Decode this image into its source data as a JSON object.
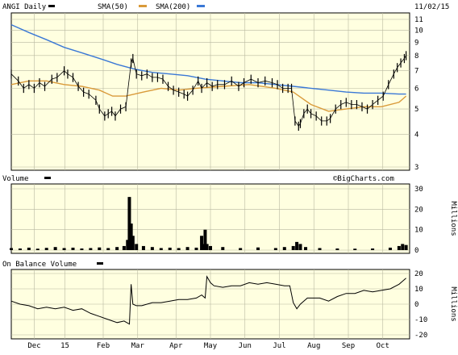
{
  "chart_data": [
    {
      "type": "line",
      "title": "ANGI Daily",
      "date": "11/02/15",
      "legend": [
        {
          "name": "ANGI Daily",
          "color": "#000000"
        },
        {
          "name": "SMA(50)",
          "color": "#d99a3a"
        },
        {
          "name": "SMA(200)",
          "color": "#3a78d6"
        }
      ],
      "x_months": [
        "Dec",
        "15",
        "Feb",
        "Mar",
        "Apr",
        "May",
        "Jun",
        "Jul",
        "Aug",
        "Sep",
        "Oct"
      ],
      "ylim": [
        3,
        11
      ],
      "y_ticks": [
        3,
        4,
        5,
        6,
        7,
        8,
        9,
        10,
        11
      ],
      "y_scale": "log",
      "grid": true,
      "series": [
        {
          "name": "ANGI Daily",
          "points": [
            [
              0,
              6.8
            ],
            [
              8,
              6.4
            ],
            [
              14,
              6.0
            ],
            [
              20,
              6.2
            ],
            [
              26,
              6.0
            ],
            [
              32,
              6.3
            ],
            [
              38,
              6.1
            ],
            [
              46,
              6.5
            ],
            [
              52,
              6.6
            ],
            [
              60,
              7.0
            ],
            [
              64,
              6.8
            ],
            [
              70,
              6.6
            ],
            [
              76,
              6.1
            ],
            [
              82,
              5.8
            ],
            [
              88,
              5.7
            ],
            [
              96,
              5.4
            ],
            [
              100,
              5.0
            ],
            [
              106,
              4.7
            ],
            [
              110,
              4.8
            ],
            [
              114,
              4.9
            ],
            [
              118,
              4.7
            ],
            [
              124,
              5.0
            ],
            [
              130,
              5.1
            ],
            [
              136,
              7.5
            ],
            [
              138,
              7.8
            ],
            [
              142,
              6.8
            ],
            [
              148,
              6.7
            ],
            [
              154,
              6.8
            ],
            [
              160,
              6.6
            ],
            [
              166,
              6.6
            ],
            [
              172,
              6.5
            ],
            [
              178,
              6.1
            ],
            [
              184,
              5.9
            ],
            [
              190,
              5.8
            ],
            [
              196,
              5.7
            ],
            [
              200,
              5.6
            ],
            [
              206,
              5.9
            ],
            [
              212,
              6.4
            ],
            [
              216,
              6.0
            ],
            [
              222,
              6.3
            ],
            [
              228,
              6.1
            ],
            [
              234,
              6.2
            ],
            [
              242,
              6.2
            ],
            [
              250,
              6.4
            ],
            [
              258,
              6.1
            ],
            [
              264,
              6.3
            ],
            [
              272,
              6.5
            ],
            [
              280,
              6.3
            ],
            [
              288,
              6.4
            ],
            [
              296,
              6.3
            ],
            [
              302,
              6.2
            ],
            [
              308,
              6.0
            ],
            [
              314,
              6.0
            ],
            [
              318,
              6.0
            ],
            [
              322,
              4.5
            ],
            [
              326,
              4.3
            ],
            [
              328,
              4.4
            ],
            [
              332,
              4.8
            ],
            [
              336,
              5.0
            ],
            [
              340,
              4.8
            ],
            [
              346,
              4.7
            ],
            [
              352,
              4.5
            ],
            [
              358,
              4.5
            ],
            [
              362,
              4.6
            ],
            [
              368,
              5.0
            ],
            [
              374,
              5.2
            ],
            [
              380,
              5.3
            ],
            [
              386,
              5.2
            ],
            [
              392,
              5.2
            ],
            [
              398,
              5.1
            ],
            [
              404,
              5.0
            ],
            [
              410,
              5.2
            ],
            [
              416,
              5.4
            ],
            [
              422,
              5.6
            ],
            [
              428,
              6.2
            ],
            [
              434,
              6.8
            ],
            [
              438,
              7.2
            ],
            [
              442,
              7.5
            ],
            [
              446,
              7.8
            ],
            [
              448,
              8.0
            ]
          ]
        },
        {
          "name": "SMA(50)",
          "points": [
            [
              0,
              6.2
            ],
            [
              20,
              6.4
            ],
            [
              40,
              6.4
            ],
            [
              60,
              6.2
            ],
            [
              80,
              6.1
            ],
            [
              100,
              5.9
            ],
            [
              115,
              5.6
            ],
            [
              130,
              5.6
            ],
            [
              150,
              5.8
            ],
            [
              170,
              6.0
            ],
            [
              190,
              5.9
            ],
            [
              210,
              6.0
            ],
            [
              240,
              6.1
            ],
            [
              270,
              6.2
            ],
            [
              300,
              6.0
            ],
            [
              320,
              5.8
            ],
            [
              340,
              5.2
            ],
            [
              360,
              4.9
            ],
            [
              380,
              5.0
            ],
            [
              400,
              5.1
            ],
            [
              420,
              5.1
            ],
            [
              440,
              5.3
            ],
            [
              448,
              5.6
            ]
          ]
        },
        {
          "name": "SMA(200)",
          "points": [
            [
              0,
              10.5
            ],
            [
              20,
              9.8
            ],
            [
              40,
              9.2
            ],
            [
              60,
              8.6
            ],
            [
              80,
              8.2
            ],
            [
              100,
              7.8
            ],
            [
              120,
              7.4
            ],
            [
              140,
              7.1
            ],
            [
              160,
              6.9
            ],
            [
              180,
              6.8
            ],
            [
              200,
              6.7
            ],
            [
              220,
              6.5
            ],
            [
              240,
              6.4
            ],
            [
              260,
              6.3
            ],
            [
              280,
              6.3
            ],
            [
              300,
              6.2
            ],
            [
              320,
              6.1
            ],
            [
              340,
              6.0
            ],
            [
              360,
              5.9
            ],
            [
              380,
              5.8
            ],
            [
              400,
              5.75
            ],
            [
              420,
              5.75
            ],
            [
              440,
              5.7
            ],
            [
              448,
              5.7
            ]
          ]
        }
      ]
    },
    {
      "type": "bar",
      "title": "Volume",
      "watermark": "©BigCharts.com",
      "ylabel": "Millions",
      "ylim": [
        0,
        30
      ],
      "y_ticks": [
        0,
        10,
        20,
        30
      ],
      "series": [
        {
          "name": "Volume",
          "points": [
            [
              0,
              1
            ],
            [
              10,
              0.8
            ],
            [
              20,
              1.2
            ],
            [
              30,
              0.7
            ],
            [
              40,
              1.1
            ],
            [
              50,
              1.5
            ],
            [
              60,
              1.0
            ],
            [
              70,
              1.2
            ],
            [
              80,
              0.8
            ],
            [
              90,
              1.0
            ],
            [
              100,
              1.3
            ],
            [
              110,
              1.0
            ],
            [
              120,
              1.5
            ],
            [
              128,
              2
            ],
            [
              132,
              5
            ],
            [
              134,
              26
            ],
            [
              136,
              13
            ],
            [
              138,
              7
            ],
            [
              142,
              3
            ],
            [
              150,
              2
            ],
            [
              160,
              1.5
            ],
            [
              170,
              1.0
            ],
            [
              180,
              1.2
            ],
            [
              190,
              1.0
            ],
            [
              200,
              1.5
            ],
            [
              210,
              1.2
            ],
            [
              216,
              7
            ],
            [
              218,
              3
            ],
            [
              220,
              10
            ],
            [
              222,
              3
            ],
            [
              226,
              2
            ],
            [
              240,
              1.5
            ],
            [
              260,
              1.0
            ],
            [
              280,
              1.3
            ],
            [
              300,
              1.0
            ],
            [
              310,
              1.5
            ],
            [
              320,
              2
            ],
            [
              324,
              4
            ],
            [
              328,
              3
            ],
            [
              334,
              1.5
            ],
            [
              350,
              1.0
            ],
            [
              370,
              0.8
            ],
            [
              390,
              0.7
            ],
            [
              410,
              0.8
            ],
            [
              430,
              1.2
            ],
            [
              440,
              2
            ],
            [
              444,
              3
            ],
            [
              448,
              2.5
            ]
          ]
        }
      ]
    },
    {
      "type": "line",
      "title": "On Balance Volume",
      "ylabel": "Millions",
      "ylim": [
        -20,
        20
      ],
      "y_ticks": [
        -20,
        -10,
        0,
        10,
        20
      ],
      "series": [
        {
          "name": "On Balance Volume",
          "points": [
            [
              0,
              2
            ],
            [
              10,
              0
            ],
            [
              20,
              -1
            ],
            [
              30,
              -3
            ],
            [
              40,
              -2
            ],
            [
              50,
              -3
            ],
            [
              60,
              -2
            ],
            [
              70,
              -4
            ],
            [
              80,
              -3
            ],
            [
              90,
              -6
            ],
            [
              100,
              -8
            ],
            [
              110,
              -10
            ],
            [
              120,
              -12
            ],
            [
              128,
              -11
            ],
            [
              134,
              -13
            ],
            [
              136,
              13
            ],
            [
              138,
              0
            ],
            [
              142,
              -1
            ],
            [
              148,
              -1
            ],
            [
              160,
              1
            ],
            [
              170,
              1
            ],
            [
              180,
              2
            ],
            [
              190,
              3
            ],
            [
              200,
              3
            ],
            [
              210,
              4
            ],
            [
              216,
              6
            ],
            [
              220,
              4
            ],
            [
              222,
              18
            ],
            [
              226,
              14
            ],
            [
              230,
              12
            ],
            [
              240,
              11
            ],
            [
              250,
              12
            ],
            [
              260,
              12
            ],
            [
              270,
              14
            ],
            [
              280,
              13
            ],
            [
              290,
              14
            ],
            [
              300,
              13
            ],
            [
              310,
              12
            ],
            [
              316,
              12
            ],
            [
              320,
              1
            ],
            [
              324,
              -3
            ],
            [
              328,
              0
            ],
            [
              336,
              4
            ],
            [
              350,
              4
            ],
            [
              360,
              2
            ],
            [
              370,
              5
            ],
            [
              380,
              7
            ],
            [
              390,
              7
            ],
            [
              400,
              9
            ],
            [
              410,
              8
            ],
            [
              420,
              9
            ],
            [
              430,
              10
            ],
            [
              440,
              13
            ],
            [
              444,
              15
            ],
            [
              448,
              17
            ]
          ]
        }
      ]
    }
  ]
}
